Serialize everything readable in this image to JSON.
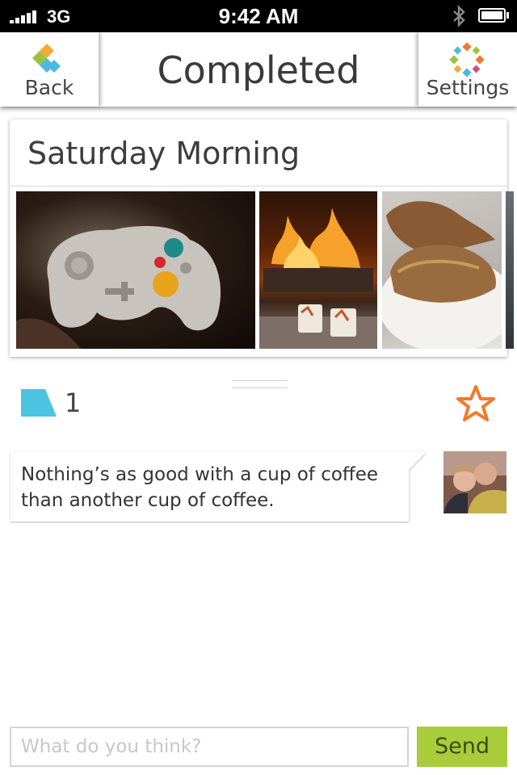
{
  "status_bar": {
    "carrier": "3G",
    "time": "9:42 AM"
  },
  "nav": {
    "back_label": "Back",
    "title": "Completed",
    "settings_label": "Settings"
  },
  "card": {
    "title": "Saturday Morning"
  },
  "stats": {
    "comment_count": "1"
  },
  "comments": [
    {
      "text": "Nothing’s as good with a cup of coffee than another cup of coffee."
    }
  ],
  "composer": {
    "placeholder": "What do you think?",
    "send_label": "Send"
  },
  "colors": {
    "accent_green": "#a8cc3a",
    "star_orange": "#f07b2a",
    "comment_blue": "#4cc3e0"
  }
}
